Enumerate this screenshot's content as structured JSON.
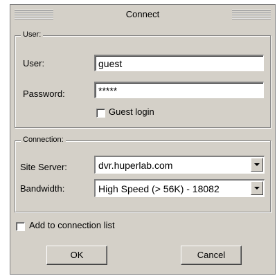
{
  "dialog": {
    "title": "Connect",
    "user_group": {
      "legend": "User:",
      "user_label": "User:",
      "user_value": "guest",
      "password_label": "Password:",
      "password_value": "*****",
      "guest_login_label": "Guest login",
      "guest_login_checked": false
    },
    "connection_group": {
      "legend": "Connection:",
      "site_server_label": "Site Server:",
      "site_server_value": "dvr.huperlab.com",
      "bandwidth_label": "Bandwidth:",
      "bandwidth_value": "High Speed (> 56K) - 18082"
    },
    "add_to_list_label": "Add to connection list",
    "add_to_list_checked": false,
    "ok_label": "OK",
    "cancel_label": "Cancel"
  }
}
